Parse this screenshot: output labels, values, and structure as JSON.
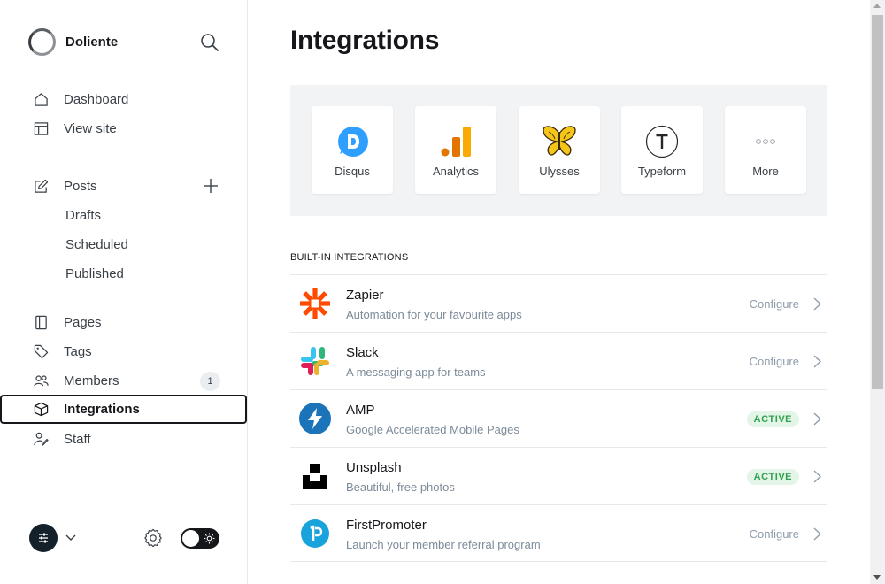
{
  "sidebar": {
    "brand_name": "Doliente",
    "nav": {
      "dashboard": "Dashboard",
      "view_site": "View site",
      "posts": "Posts",
      "drafts": "Drafts",
      "scheduled": "Scheduled",
      "published": "Published",
      "pages": "Pages",
      "tags": "Tags",
      "members": "Members",
      "integrations": "Integrations",
      "staff": "Staff"
    },
    "members_count": "1",
    "active_item": "Integrations"
  },
  "main": {
    "title": "Integrations",
    "featured": [
      {
        "label": "Disqus",
        "icon": "disqus-icon"
      },
      {
        "label": "Analytics",
        "icon": "analytics-icon"
      },
      {
        "label": "Ulysses",
        "icon": "butterfly-icon"
      },
      {
        "label": "Typeform",
        "icon": "typeform-icon"
      },
      {
        "label": "More",
        "icon": "more-icon"
      }
    ],
    "section_title": "BUILT-IN INTEGRATIONS",
    "integrations": [
      {
        "name": "Zapier",
        "description": "Automation for your favourite apps",
        "status": "Configure",
        "icon": "zapier-icon"
      },
      {
        "name": "Slack",
        "description": "A messaging app for teams",
        "status": "Configure",
        "icon": "slack-icon"
      },
      {
        "name": "AMP",
        "description": "Google Accelerated Mobile Pages",
        "status": "ACTIVE",
        "icon": "amp-icon"
      },
      {
        "name": "Unsplash",
        "description": "Beautiful, free photos",
        "status": "ACTIVE",
        "icon": "unsplash-icon"
      },
      {
        "name": "FirstPromoter",
        "description": "Launch your member referral program",
        "status": "Configure",
        "icon": "firstpromoter-icon"
      }
    ]
  },
  "colors": {
    "active_badge_bg": "#e3f5e7",
    "active_badge_text": "#30a14e",
    "text_primary": "#15171a",
    "text_muted": "#7c8b9a"
  }
}
